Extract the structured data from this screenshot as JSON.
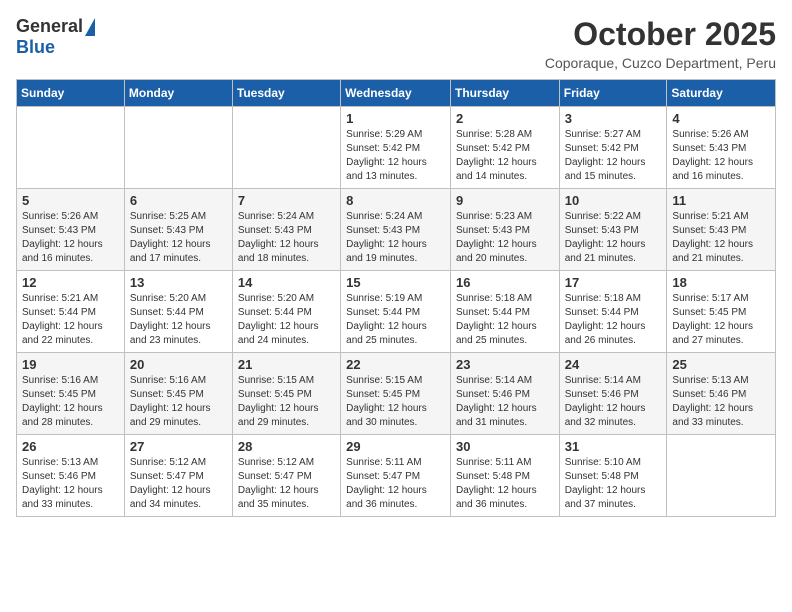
{
  "header": {
    "logo_general": "General",
    "logo_blue": "Blue",
    "month_title": "October 2025",
    "location": "Coporaque, Cuzco Department, Peru"
  },
  "weekdays": [
    "Sunday",
    "Monday",
    "Tuesday",
    "Wednesday",
    "Thursday",
    "Friday",
    "Saturday"
  ],
  "weeks": [
    [
      {
        "day": "",
        "content": ""
      },
      {
        "day": "",
        "content": ""
      },
      {
        "day": "",
        "content": ""
      },
      {
        "day": "1",
        "content": "Sunrise: 5:29 AM\nSunset: 5:42 PM\nDaylight: 12 hours\nand 13 minutes."
      },
      {
        "day": "2",
        "content": "Sunrise: 5:28 AM\nSunset: 5:42 PM\nDaylight: 12 hours\nand 14 minutes."
      },
      {
        "day": "3",
        "content": "Sunrise: 5:27 AM\nSunset: 5:42 PM\nDaylight: 12 hours\nand 15 minutes."
      },
      {
        "day": "4",
        "content": "Sunrise: 5:26 AM\nSunset: 5:43 PM\nDaylight: 12 hours\nand 16 minutes."
      }
    ],
    [
      {
        "day": "5",
        "content": "Sunrise: 5:26 AM\nSunset: 5:43 PM\nDaylight: 12 hours\nand 16 minutes."
      },
      {
        "day": "6",
        "content": "Sunrise: 5:25 AM\nSunset: 5:43 PM\nDaylight: 12 hours\nand 17 minutes."
      },
      {
        "day": "7",
        "content": "Sunrise: 5:24 AM\nSunset: 5:43 PM\nDaylight: 12 hours\nand 18 minutes."
      },
      {
        "day": "8",
        "content": "Sunrise: 5:24 AM\nSunset: 5:43 PM\nDaylight: 12 hours\nand 19 minutes."
      },
      {
        "day": "9",
        "content": "Sunrise: 5:23 AM\nSunset: 5:43 PM\nDaylight: 12 hours\nand 20 minutes."
      },
      {
        "day": "10",
        "content": "Sunrise: 5:22 AM\nSunset: 5:43 PM\nDaylight: 12 hours\nand 21 minutes."
      },
      {
        "day": "11",
        "content": "Sunrise: 5:21 AM\nSunset: 5:43 PM\nDaylight: 12 hours\nand 21 minutes."
      }
    ],
    [
      {
        "day": "12",
        "content": "Sunrise: 5:21 AM\nSunset: 5:44 PM\nDaylight: 12 hours\nand 22 minutes."
      },
      {
        "day": "13",
        "content": "Sunrise: 5:20 AM\nSunset: 5:44 PM\nDaylight: 12 hours\nand 23 minutes."
      },
      {
        "day": "14",
        "content": "Sunrise: 5:20 AM\nSunset: 5:44 PM\nDaylight: 12 hours\nand 24 minutes."
      },
      {
        "day": "15",
        "content": "Sunrise: 5:19 AM\nSunset: 5:44 PM\nDaylight: 12 hours\nand 25 minutes."
      },
      {
        "day": "16",
        "content": "Sunrise: 5:18 AM\nSunset: 5:44 PM\nDaylight: 12 hours\nand 25 minutes."
      },
      {
        "day": "17",
        "content": "Sunrise: 5:18 AM\nSunset: 5:44 PM\nDaylight: 12 hours\nand 26 minutes."
      },
      {
        "day": "18",
        "content": "Sunrise: 5:17 AM\nSunset: 5:45 PM\nDaylight: 12 hours\nand 27 minutes."
      }
    ],
    [
      {
        "day": "19",
        "content": "Sunrise: 5:16 AM\nSunset: 5:45 PM\nDaylight: 12 hours\nand 28 minutes."
      },
      {
        "day": "20",
        "content": "Sunrise: 5:16 AM\nSunset: 5:45 PM\nDaylight: 12 hours\nand 29 minutes."
      },
      {
        "day": "21",
        "content": "Sunrise: 5:15 AM\nSunset: 5:45 PM\nDaylight: 12 hours\nand 29 minutes."
      },
      {
        "day": "22",
        "content": "Sunrise: 5:15 AM\nSunset: 5:45 PM\nDaylight: 12 hours\nand 30 minutes."
      },
      {
        "day": "23",
        "content": "Sunrise: 5:14 AM\nSunset: 5:46 PM\nDaylight: 12 hours\nand 31 minutes."
      },
      {
        "day": "24",
        "content": "Sunrise: 5:14 AM\nSunset: 5:46 PM\nDaylight: 12 hours\nand 32 minutes."
      },
      {
        "day": "25",
        "content": "Sunrise: 5:13 AM\nSunset: 5:46 PM\nDaylight: 12 hours\nand 33 minutes."
      }
    ],
    [
      {
        "day": "26",
        "content": "Sunrise: 5:13 AM\nSunset: 5:46 PM\nDaylight: 12 hours\nand 33 minutes."
      },
      {
        "day": "27",
        "content": "Sunrise: 5:12 AM\nSunset: 5:47 PM\nDaylight: 12 hours\nand 34 minutes."
      },
      {
        "day": "28",
        "content": "Sunrise: 5:12 AM\nSunset: 5:47 PM\nDaylight: 12 hours\nand 35 minutes."
      },
      {
        "day": "29",
        "content": "Sunrise: 5:11 AM\nSunset: 5:47 PM\nDaylight: 12 hours\nand 36 minutes."
      },
      {
        "day": "30",
        "content": "Sunrise: 5:11 AM\nSunset: 5:48 PM\nDaylight: 12 hours\nand 36 minutes."
      },
      {
        "day": "31",
        "content": "Sunrise: 5:10 AM\nSunset: 5:48 PM\nDaylight: 12 hours\nand 37 minutes."
      },
      {
        "day": "",
        "content": ""
      }
    ]
  ]
}
